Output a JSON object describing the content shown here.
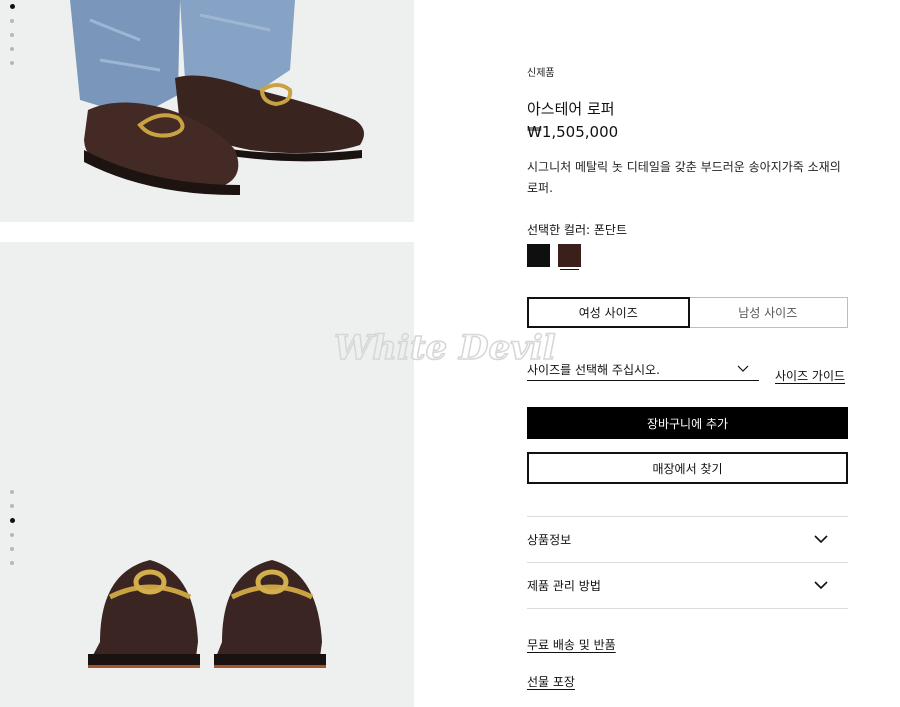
{
  "product": {
    "tag": "신제품",
    "name": "아스테어 로퍼",
    "price": "₩1,505,000",
    "description": "시그니처 메탈릭 놋 디테일을 갖춘 부드러운 송아지가죽 소재의 로퍼.",
    "color_label": "선택한 컬러: 폰단트"
  },
  "swatches": [
    {
      "name": "black",
      "color": "#0f0f10"
    },
    {
      "name": "fondant",
      "color": "#3a1f1a"
    }
  ],
  "size_tabs": [
    "여성 사이즈",
    "남성 사이즈"
  ],
  "size_select": {
    "value": "사이즈를 선택해 주십시오."
  },
  "size_guide_label": "사이즈 가이드",
  "buttons": {
    "add_to_cart": "장바구니에 추가",
    "find_in_store": "매장에서 찾기"
  },
  "accordion": [
    {
      "label": "상품정보"
    },
    {
      "label": "제품 관리 방법"
    }
  ],
  "links": {
    "shipping": "무료 배송 및 반품",
    "gift": "선물 포장"
  },
  "watermark_text": "White Devil"
}
